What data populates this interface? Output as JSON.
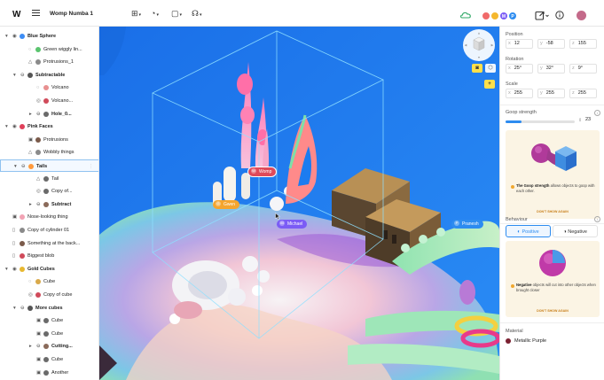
{
  "app": {
    "logo_text": "W",
    "project_title": "Womp Numba 1"
  },
  "toolbar": {
    "tools": [
      {
        "name": "grid-tool",
        "glyph": "⊞"
      },
      {
        "name": "material-tool",
        "glyph": "◔"
      },
      {
        "name": "frame-tool",
        "glyph": "▢"
      },
      {
        "name": "lasso-tool",
        "glyph": "☊"
      }
    ],
    "right_icons": [
      "cloud-icon",
      "export-icon",
      "info-icon"
    ],
    "collaborators": [
      {
        "initial": "",
        "color": "#f06a6a"
      },
      {
        "initial": "",
        "color": "#f5b82e"
      },
      {
        "initial": "M",
        "color": "#7b5cf5"
      },
      {
        "initial": "P",
        "color": "#2d8cf0"
      }
    ],
    "user_avatar_color": "#c46a8a"
  },
  "colors": {
    "accent": "#2d8cf0",
    "pink": "#f06a8a",
    "gold": "#e8b830",
    "selected_border": "#8fc2f0",
    "tip_bg": "#fbf4e4",
    "tip_link": "#c77d16"
  },
  "scene_tree": [
    {
      "label": "Blue Sphere",
      "depth": 0,
      "group": true,
      "ball": "#3d8df5",
      "chev": "▾",
      "icon": "eye-icon"
    },
    {
      "label": "Green wiggly lin...",
      "depth": 2,
      "group": false,
      "ball": "#5ac46e",
      "chev": "",
      "icon": "ghost-icon"
    },
    {
      "label": "Protrusions_1",
      "depth": 2,
      "group": false,
      "ball": "#8a8a8a",
      "chev": "",
      "icon": "triangle-icon"
    },
    {
      "label": "Subtractable",
      "depth": 1,
      "group": true,
      "ball": "#555555",
      "chev": "▾",
      "icon": "subtract-icon"
    },
    {
      "label": "Volcano",
      "depth": 3,
      "group": false,
      "ball": "#e89090",
      "chev": "",
      "icon": "ghost-icon"
    },
    {
      "label": "Volcano...",
      "depth": 3,
      "group": false,
      "ball": "#d04a5a",
      "chev": "",
      "icon": "ring-icon"
    },
    {
      "label": "Hole_0...",
      "depth": 3,
      "group": true,
      "ball": "#6a6a6a",
      "chev": "▸",
      "icon": "subtract-icon"
    },
    {
      "label": "Pink Faces",
      "depth": 0,
      "group": true,
      "ball": "#e0405a",
      "chev": "▾",
      "icon": "eye-icon"
    },
    {
      "label": "Protrusions",
      "depth": 2,
      "group": false,
      "ball": "#7a5a4a",
      "chev": "",
      "icon": "cube-icon"
    },
    {
      "label": "Wobbly things",
      "depth": 2,
      "group": false,
      "ball": "#8a8a8a",
      "chev": "",
      "icon": "triangle-icon"
    },
    {
      "label": "Tails",
      "depth": 1,
      "group": true,
      "ball": "#ff9a3c",
      "chev": "▾",
      "icon": "subtract-icon",
      "selected": true
    },
    {
      "label": "Tail",
      "depth": 3,
      "group": false,
      "ball": "#6a6a6a",
      "chev": "",
      "icon": "triangle-icon"
    },
    {
      "label": "Copy of...",
      "depth": 3,
      "group": false,
      "ball": "#6a6a6a",
      "chev": "",
      "icon": "ring-icon"
    },
    {
      "label": "Subtract",
      "depth": 3,
      "group": true,
      "ball": "#8a6a5a",
      "chev": "▸",
      "icon": "subtract-icon"
    },
    {
      "label": "Nose-looking thing",
      "depth": 0,
      "group": false,
      "ball": "#f2a3b4",
      "chev": "",
      "icon": "cube-icon"
    },
    {
      "label": "Copy of cylinder 01",
      "depth": 0,
      "group": false,
      "ball": "#8a8a8a",
      "chev": "",
      "icon": "cylinder-icon"
    },
    {
      "label": "Something at the back...",
      "depth": 0,
      "group": false,
      "ball": "#7a5a4a",
      "chev": "",
      "icon": "cylinder-icon"
    },
    {
      "label": "Biggest blob",
      "depth": 0,
      "group": false,
      "ball": "#d04a5a",
      "chev": "",
      "icon": "cylinder-icon"
    },
    {
      "label": "Gold Cubes",
      "depth": 0,
      "group": true,
      "ball": "#e8b830",
      "chev": "▾",
      "icon": "eye-icon"
    },
    {
      "label": "Cube",
      "depth": 2,
      "group": false,
      "ball": "#d9a94a",
      "chev": "",
      "icon": "ghost-icon"
    },
    {
      "label": "Copy of cube",
      "depth": 2,
      "group": false,
      "ball": "#d04a5a",
      "chev": "",
      "icon": "ring-icon"
    },
    {
      "label": "More cubes",
      "depth": 1,
      "group": true,
      "ball": "#555555",
      "chev": "▾",
      "icon": "subtract-icon"
    },
    {
      "label": "Cube",
      "depth": 3,
      "group": false,
      "ball": "#6a6a6a",
      "chev": "",
      "icon": "cube-icon"
    },
    {
      "label": "Cube",
      "depth": 3,
      "group": false,
      "ball": "#6a6a6a",
      "chev": "",
      "icon": "cube-icon"
    },
    {
      "label": "Cutting...",
      "depth": 3,
      "group": true,
      "ball": "#8a6a5a",
      "chev": "▸",
      "icon": "subtract-icon"
    },
    {
      "label": "Cube",
      "depth": 3,
      "group": false,
      "ball": "#6a6a6a",
      "chev": "",
      "icon": "cube-icon"
    },
    {
      "label": "Another",
      "depth": 3,
      "group": false,
      "ball": "#6a6a6a",
      "chev": "",
      "icon": "cube-icon"
    }
  ],
  "viewport": {
    "tags": [
      {
        "initial": "W",
        "label": "Womp",
        "color": "#e04a5a",
        "selected": true
      },
      {
        "initial": "G",
        "label": "Gwen",
        "color": "#f5a52e",
        "selected": false
      },
      {
        "initial": "M",
        "label": "Michael",
        "color": "#7b5cf5",
        "selected": false
      },
      {
        "initial": "P",
        "label": "Pranesh",
        "color": "#2d8cf0",
        "selected": false
      }
    ],
    "view_buttons": [
      "camera-view-icon",
      "perspective-icon",
      "zoom-in-icon"
    ]
  },
  "properties": {
    "position": {
      "title": "Position",
      "x": "12",
      "y": "-58",
      "z": "155"
    },
    "rotation": {
      "title": "Rotation",
      "x": "25°",
      "y": "32°",
      "z": "9°"
    },
    "scale": {
      "title": "Scale",
      "x": "255",
      "y": "255",
      "z": "255"
    },
    "goop": {
      "title": "Goop strength",
      "value": "23",
      "fraction": 0.23,
      "tip_strong": "The Goop strength",
      "tip_rest": " allows objects to goop with each other.",
      "tip_link": "DON'T SHOW AGAIN"
    },
    "behaviour": {
      "title": "Behaviour",
      "positive": "Positive",
      "negative": "Negative",
      "active": "positive",
      "tip_strong": "Negative",
      "tip_rest": " objects will cut into other objects when brought closer",
      "tip_link": "DON'T SHOW AGAIN"
    },
    "material": {
      "title": "Material",
      "name": "Metallic Purple",
      "color": "#7a2030"
    }
  },
  "axis_labels": {
    "x": "x",
    "y": "y",
    "z": "z"
  }
}
